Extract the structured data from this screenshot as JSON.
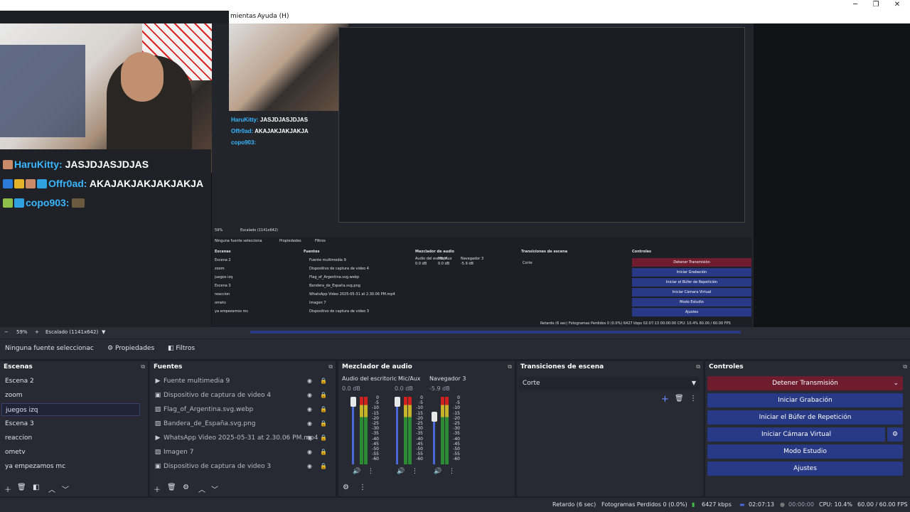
{
  "menu": {
    "item1": "mientas",
    "item2": "Ayuda (H)"
  },
  "window_controls": {
    "minimize": "─",
    "restore": "❐",
    "close": "✕"
  },
  "chat": [
    {
      "user": "HaruKitty:",
      "msg": "JASJDJASJDJAS"
    },
    {
      "user": "Offr0ad:",
      "msg": "AKAJAKJAKJAKJAKJA"
    },
    {
      "user": "copo903:",
      "msg": ""
    }
  ],
  "nested_chat": [
    {
      "user": "HaruKitty:",
      "msg": "JASJDJASJDJAS"
    },
    {
      "user": "Offr0ad:",
      "msg": "AKAJAKJAKJAKJA"
    },
    {
      "user": "copo903:",
      "msg": ""
    }
  ],
  "zoom": {
    "minus": "−",
    "value": "59%",
    "plus": "+",
    "scale_label": "Escalado (1141x642)"
  },
  "context": {
    "no_source": "Ninguna fuente seleccionac",
    "properties": "Propiedades",
    "filters": "Filtros"
  },
  "scenes": {
    "title": "Escenas",
    "items": [
      "Escena 2",
      "zoom",
      "juegos izq",
      "Escena 3",
      "reaccion",
      "ometv",
      "ya empezamos mc"
    ],
    "selected": "juegos izq"
  },
  "sources": {
    "title": "Fuentes",
    "items": [
      {
        "icon": "play-icon",
        "name": "Fuente multimedia 9"
      },
      {
        "icon": "camera-icon",
        "name": "Dispositivo de captura de video 4"
      },
      {
        "icon": "image-icon",
        "name": "Flag_of_Argentina.svg.webp"
      },
      {
        "icon": "image-icon",
        "name": "Bandera_de_España.svg.png"
      },
      {
        "icon": "play-icon",
        "name": "WhatsApp Video 2025-05-31 at 2.30.06 PM.mp4"
      },
      {
        "icon": "image-icon",
        "name": "Imagen 7"
      },
      {
        "icon": "camera-icon",
        "name": "Dispositivo de captura de video 3"
      }
    ]
  },
  "mixer": {
    "title": "Mezclador de audio",
    "channels": [
      {
        "name": "Audio del escritoric",
        "db": "0.0 dB",
        "level": 1.0
      },
      {
        "name": "Mic/Aux",
        "db": "0.0 dB",
        "level": 1.0
      },
      {
        "name": "Navegador 3",
        "db": "-5.9 dB",
        "level": 0.78
      }
    ],
    "scale": [
      "0",
      "-5",
      "-10",
      "-15",
      "-20",
      "-25",
      "-30",
      "-35",
      "-40",
      "-45",
      "-50",
      "-55",
      "-60"
    ]
  },
  "transitions": {
    "title": "Transiciones de escena",
    "selected": "Corte"
  },
  "controls": {
    "title": "Controles",
    "stop_stream": "Detener Transmisión",
    "start_recording": "Iniciar Grabación",
    "replay_buffer": "Iniciar el Búfer de Repetición",
    "virtual_cam": "Iniciar Cámara Virtual",
    "studio_mode": "Modo Estudio",
    "settings": "Ajustes"
  },
  "status": {
    "delay": "Retardo (6 sec)",
    "dropped": "Fotogramas Perdidos 0 (0.0%)",
    "kbps": "6427 kbps",
    "stream_time": "02:07:13",
    "rec_time": "00:00:00",
    "cpu": "CPU: 10.4%",
    "fps": "60.00 / 60.00 FPS"
  },
  "nested": {
    "no_source": "Ninguna fuente selecciona",
    "properties": "Propiedades",
    "filters": "Filtros",
    "scenes_title": "Escenas",
    "sources_title": "Fuentes",
    "mixer_title": "Mezclador de audio",
    "trans_title": "Transiciones de escena",
    "controls_title": "Controles",
    "scenes": [
      "Escena 2",
      "zoom",
      "juegos izq",
      "Escena 3",
      "reaccion",
      "ometv",
      "ya empezamos mc"
    ],
    "sources": [
      "Fuente multimedia 9",
      "Dispositivo de captura de video 4",
      "Flag_of_Argentina.svg.webp",
      "Bandera_de_España.svg.png",
      "WhatsApp Video 2025-05-31 at 2.30.06 PM.mp4",
      "Imagen 7",
      "Dispositivo de captura de video 3"
    ],
    "channels": [
      "Audio del escritori",
      "Mic/Aux",
      "Navegador 3"
    ],
    "channel_db": [
      "0.0 dB",
      "0.0 dB",
      "-5.9 dB"
    ],
    "trans": "Corte",
    "buttons": [
      "Detener Transmisión",
      "Iniciar Grabación",
      "Iniciar el Búfer de Repetición",
      "Iniciar Cámara Virtual",
      "Modo Estudio",
      "Ajustes"
    ],
    "zoom": "59%",
    "scale_label": "Escalado (1141x642)",
    "status": "Retardo (6 sec)   Fotogramas Perdidos 0 (0.0%)   6427 kbps   02:07:13   00:00:00   CPU: 10.4%   60.00 / 60.00 FPS"
  },
  "colors": {
    "accent": "#283a86",
    "stop": "#6e1c2e",
    "dock": "#272a33",
    "chat_user": "#39b6ff"
  }
}
